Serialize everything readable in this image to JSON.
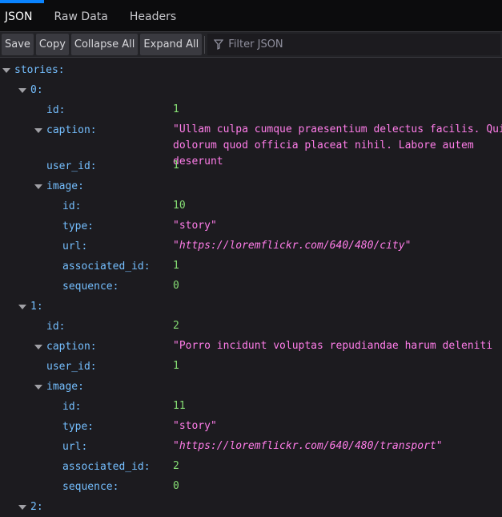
{
  "tabs": [
    {
      "label": "JSON",
      "active": true
    },
    {
      "label": "Raw Data"
    },
    {
      "label": "Headers"
    }
  ],
  "toolbar": {
    "save": "Save",
    "copy": "Copy",
    "collapse_all": "Collapse All",
    "expand_all": "Expand All",
    "filter_placeholder": "Filter JSON"
  },
  "rows": [
    {
      "level": 0,
      "key": "stories:",
      "toggle": true
    },
    {
      "level": 1,
      "key": "0:",
      "toggle": true
    },
    {
      "level": 2,
      "key": "id:",
      "value": "1",
      "type": "num"
    },
    {
      "level": 2,
      "key": "caption:",
      "toggle": true,
      "value": "\"Ullam culpa cumque praesentium delectus facilis. Quis dolorum quod officia placeat nihil. Labore autem deserunt",
      "type": "str",
      "tall": true
    },
    {
      "level": 2,
      "key": "user_id:",
      "value": "1",
      "type": "num"
    },
    {
      "level": 2,
      "key": "image:",
      "toggle": true
    },
    {
      "level": 3,
      "key": "id:",
      "value": "10",
      "type": "num"
    },
    {
      "level": 3,
      "key": "type:",
      "value": "\"story\"",
      "type": "str"
    },
    {
      "level": 3,
      "key": "url:",
      "value": "\"https://loremflickr.com/640/480/city\"",
      "type": "url"
    },
    {
      "level": 3,
      "key": "associated_id:",
      "value": "1",
      "type": "num"
    },
    {
      "level": 3,
      "key": "sequence:",
      "value": "0",
      "type": "num"
    },
    {
      "level": 1,
      "key": "1:",
      "toggle": true
    },
    {
      "level": 2,
      "key": "id:",
      "value": "2",
      "type": "num"
    },
    {
      "level": 2,
      "key": "caption:",
      "toggle": true,
      "value": "\"Porro incidunt voluptas repudiandae harum deleniti",
      "type": "str"
    },
    {
      "level": 2,
      "key": "user_id:",
      "value": "1",
      "type": "num"
    },
    {
      "level": 2,
      "key": "image:",
      "toggle": true
    },
    {
      "level": 3,
      "key": "id:",
      "value": "11",
      "type": "num"
    },
    {
      "level": 3,
      "key": "type:",
      "value": "\"story\"",
      "type": "str"
    },
    {
      "level": 3,
      "key": "url:",
      "value": "\"https://loremflickr.com/640/480/transport\"",
      "type": "url"
    },
    {
      "level": 3,
      "key": "associated_id:",
      "value": "2",
      "type": "num"
    },
    {
      "level": 3,
      "key": "sequence:",
      "value": "0",
      "type": "num"
    },
    {
      "level": 1,
      "key": "2:",
      "toggle": true
    }
  ]
}
